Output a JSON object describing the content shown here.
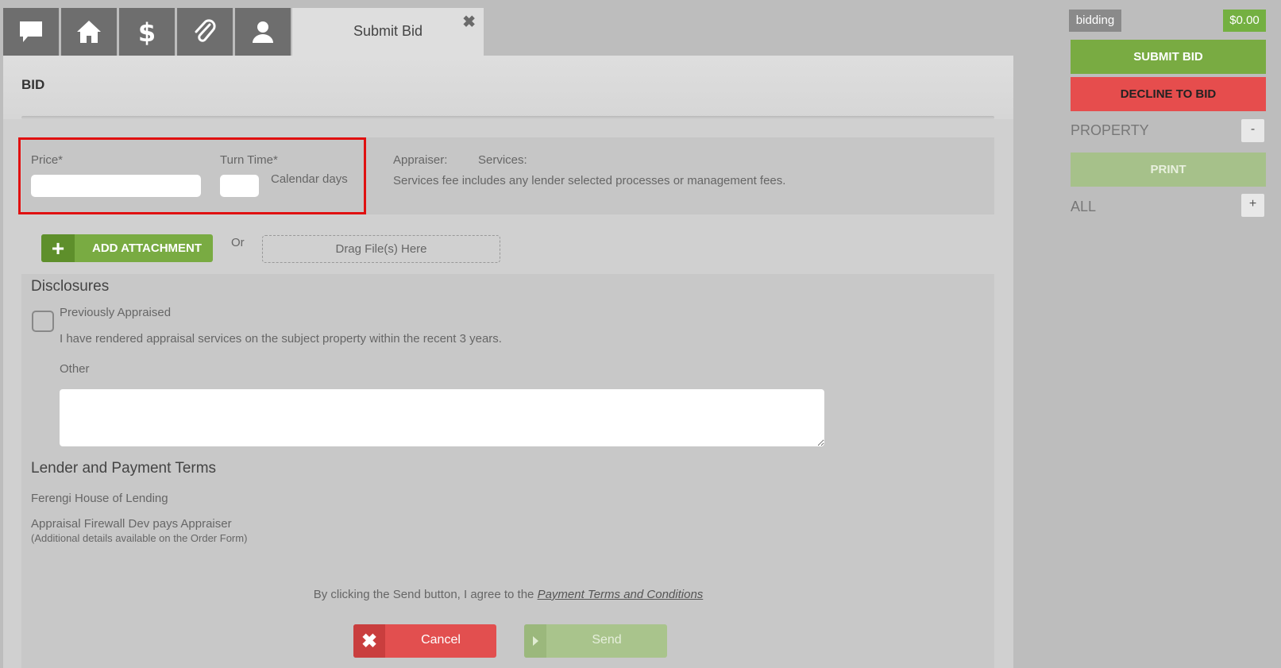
{
  "tabs": {
    "icons": [
      "chat-icon",
      "home-icon",
      "dollar-icon",
      "paperclip-icon",
      "user-icon"
    ],
    "active_label": "Submit Bid",
    "close_glyph": "✖"
  },
  "bid": {
    "title": "BID",
    "price_label": "Price*",
    "turn_time_label": "Turn Time*",
    "calendar_days_label": "Calendar days",
    "appraiser_label": "Appraiser:",
    "services_label": "Services:",
    "services_note": "Services fee includes any lender selected processes or management fees."
  },
  "attachments": {
    "add_label": "ADD ATTACHMENT",
    "or_label": "Or",
    "drop_label": "Drag File(s) Here"
  },
  "disclosures": {
    "title": "Disclosures",
    "previously_appraised_label": "Previously Appraised",
    "previously_appraised_desc": "I have rendered appraisal services on the subject property within the recent 3 years.",
    "other_label": "Other"
  },
  "terms": {
    "title": "Lender and Payment Terms",
    "lender": "Ferengi House of Lending",
    "payer": "Appraisal Firewall Dev pays Appraiser",
    "note": "(Additional details available on the Order Form)",
    "agree_prefix": "By clicking the Send button, I agree to the ",
    "agree_link": "Payment Terms and Conditions"
  },
  "actions": {
    "cancel_label": "Cancel",
    "cancel_glyph": "✖",
    "send_label": "Send"
  },
  "sidebar": {
    "status": "bidding",
    "amount": "$0.00",
    "submit_label": "SUBMIT BID",
    "decline_label": "DECLINE TO BID",
    "property_label": "PROPERTY",
    "property_toggle": "-",
    "print_label": "PRINT",
    "all_label": "ALL",
    "all_toggle": "+"
  },
  "colors": {
    "accent_green": "#79ab42",
    "danger_red": "#e64d4d",
    "highlight_red": "#e01010"
  }
}
